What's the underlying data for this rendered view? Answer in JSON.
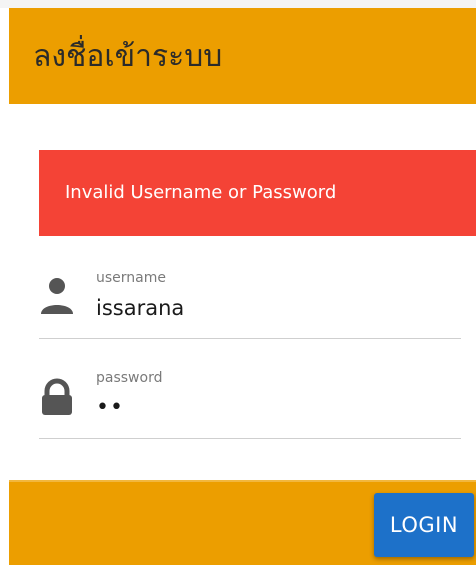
{
  "header": {
    "title": "ลงชื่อเข้าระบบ"
  },
  "alert": {
    "message": "Invalid Username or Password"
  },
  "form": {
    "username": {
      "label": "username",
      "value": "issarana",
      "icon": "person-icon"
    },
    "password": {
      "label": "password",
      "value": "••",
      "icon": "lock-icon"
    }
  },
  "footer": {
    "login_label": "LOGIN"
  },
  "colors": {
    "header_bg": "#ec9e00",
    "alert_bg": "#f44336",
    "button_bg": "#1d71c9",
    "icon": "#555555"
  }
}
